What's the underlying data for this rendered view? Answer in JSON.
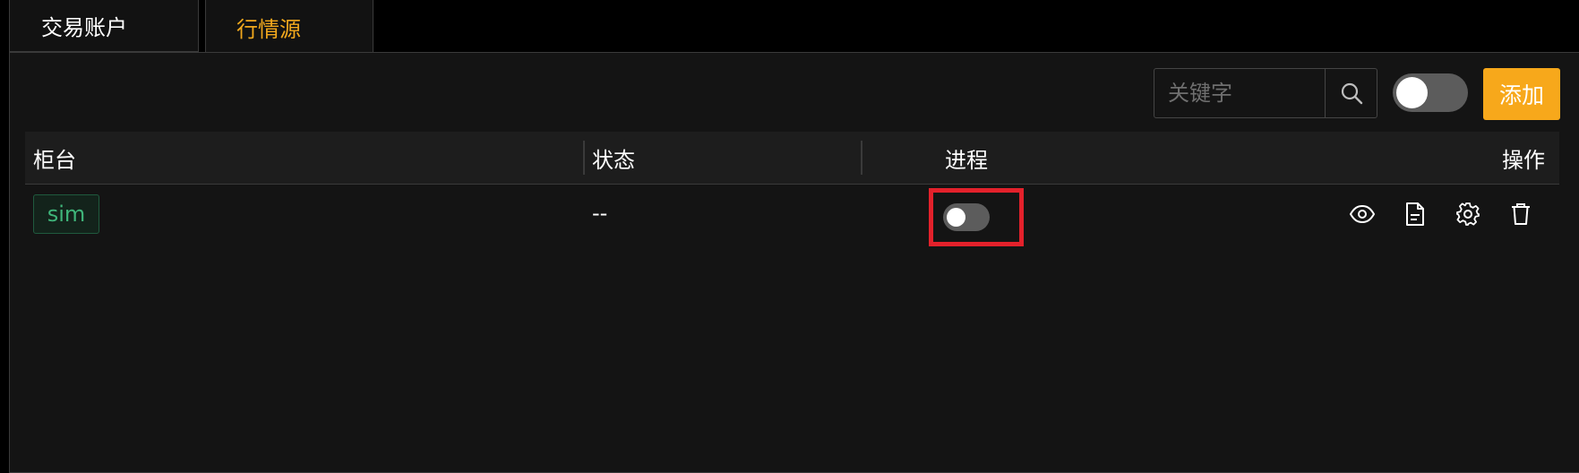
{
  "tabs": [
    {
      "label": "交易账户",
      "active": false
    },
    {
      "label": "行情源",
      "active": true
    }
  ],
  "toolbar": {
    "search_placeholder": "关键字",
    "search_value": "",
    "global_switch_on": false,
    "add_label": "添加"
  },
  "table": {
    "columns": [
      "柜台",
      "状态",
      "进程",
      "操作"
    ],
    "rows": [
      {
        "counter": "sim",
        "status": "--",
        "process_on": false
      }
    ]
  },
  "icons": {
    "search": "search-icon",
    "view": "eye-icon",
    "log": "document-icon",
    "settings": "gear-icon",
    "delete": "trash-icon"
  },
  "colors": {
    "accent": "#f7a81b",
    "active_tab_text": "#f2a81d",
    "tag_text": "#3fb57a",
    "highlight": "#e3212b"
  }
}
